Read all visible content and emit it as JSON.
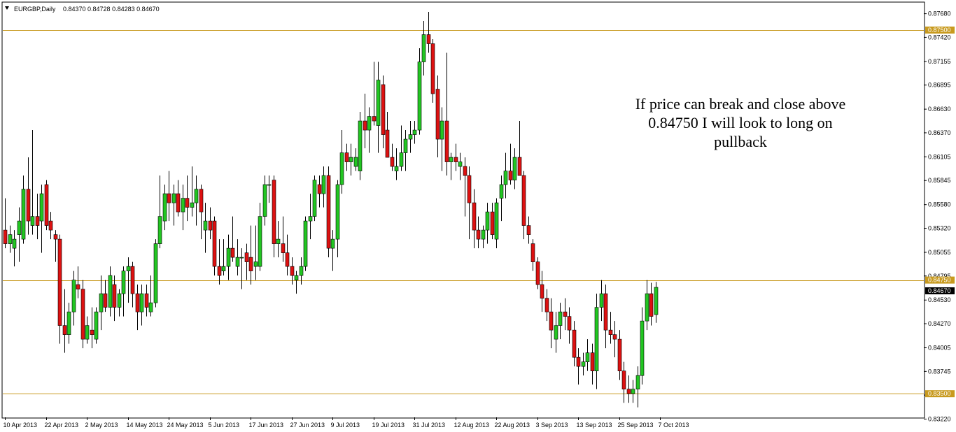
{
  "header": {
    "symbol": "EURGBP,Daily",
    "ohlc": "0.84370 0.84728 0.84283 0.84670"
  },
  "annotation": [
    "If price can break and close above",
    "0.84750 I will look to long on",
    "pullback"
  ],
  "colors": {
    "bull": "#22c622",
    "bear": "#dd1111",
    "outline": "#000000",
    "level_line": "#c89a1e",
    "level_label_bg": "#c89a1e",
    "current_label_bg": "#000000",
    "background": "#ffffff"
  },
  "y_axis": {
    "min": 0.8324,
    "max": 0.878,
    "ticks": [
      "0.87680",
      "0.87420",
      "0.87155",
      "0.86895",
      "0.86630",
      "0.86370",
      "0.86105",
      "0.85845",
      "0.85580",
      "0.85320",
      "0.85055",
      "0.84795",
      "0.84530",
      "0.84270",
      "0.84005",
      "0.83745",
      "0.83485",
      "0.83220"
    ]
  },
  "x_axis": {
    "labels": [
      "10 Apr 2013",
      "22 Apr 2013",
      "2 May 2013",
      "14 May 2013",
      "24 May 2013",
      "5 Jun 2013",
      "17 Jun 2013",
      "27 Jun 2013",
      "9 Jul 2013",
      "19 Jul 2013",
      "31 Jul 2013",
      "12 Aug 2013",
      "22 Aug 2013",
      "3 Sep 2013",
      "13 Sep 2013",
      "25 Sep 2013",
      "7 Oct 2013"
    ]
  },
  "levels": [
    {
      "value": 0.875,
      "label": "0.87500"
    },
    {
      "value": 0.8475,
      "label": "0.84750"
    },
    {
      "value": 0.835,
      "label": "0.83500"
    }
  ],
  "current_price": {
    "value": 0.8467,
    "label": "0.84670"
  },
  "chart_data": {
    "type": "candlestick",
    "symbol": "EURGBP",
    "timeframe": "Daily",
    "series": [
      {
        "date": "2013-04-09",
        "o": 0.853,
        "h": 0.8565,
        "l": 0.851,
        "c": 0.8515
      },
      {
        "date": "2013-04-10",
        "o": 0.8515,
        "h": 0.8535,
        "l": 0.8505,
        "c": 0.8525
      },
      {
        "date": "2013-04-11",
        "o": 0.851,
        "h": 0.853,
        "l": 0.849,
        "c": 0.852
      },
      {
        "date": "2013-04-12",
        "o": 0.8525,
        "h": 0.8555,
        "l": 0.8495,
        "c": 0.854
      },
      {
        "date": "2013-04-15",
        "o": 0.852,
        "h": 0.859,
        "l": 0.8515,
        "c": 0.8575
      },
      {
        "date": "2013-04-16",
        "o": 0.8575,
        "h": 0.861,
        "l": 0.8525,
        "c": 0.854
      },
      {
        "date": "2013-04-17",
        "o": 0.8535,
        "h": 0.864,
        "l": 0.8525,
        "c": 0.8545
      },
      {
        "date": "2013-04-18",
        "o": 0.8545,
        "h": 0.857,
        "l": 0.852,
        "c": 0.8535
      },
      {
        "date": "2013-04-19",
        "o": 0.854,
        "h": 0.858,
        "l": 0.8505,
        "c": 0.857
      },
      {
        "date": "2013-04-22",
        "o": 0.858,
        "h": 0.8585,
        "l": 0.853,
        "c": 0.8535
      },
      {
        "date": "2013-04-23",
        "o": 0.854,
        "h": 0.855,
        "l": 0.852,
        "c": 0.853
      },
      {
        "date": "2013-04-24",
        "o": 0.8525,
        "h": 0.853,
        "l": 0.8495,
        "c": 0.852
      },
      {
        "date": "2013-04-25",
        "o": 0.852,
        "h": 0.8525,
        "l": 0.8405,
        "c": 0.8425
      },
      {
        "date": "2013-04-26",
        "o": 0.8425,
        "h": 0.8465,
        "l": 0.8395,
        "c": 0.8415
      },
      {
        "date": "2013-04-29",
        "o": 0.8415,
        "h": 0.845,
        "l": 0.8405,
        "c": 0.844
      },
      {
        "date": "2013-04-30",
        "o": 0.844,
        "h": 0.8485,
        "l": 0.8425,
        "c": 0.8475
      },
      {
        "date": "2013-05-01",
        "o": 0.847,
        "h": 0.849,
        "l": 0.8455,
        "c": 0.8465
      },
      {
        "date": "2013-05-02",
        "o": 0.8465,
        "h": 0.8475,
        "l": 0.84,
        "c": 0.841
      },
      {
        "date": "2013-05-03",
        "o": 0.841,
        "h": 0.8435,
        "l": 0.8405,
        "c": 0.8425
      },
      {
        "date": "2013-05-06",
        "o": 0.842,
        "h": 0.8445,
        "l": 0.84,
        "c": 0.8415
      },
      {
        "date": "2013-05-07",
        "o": 0.841,
        "h": 0.8445,
        "l": 0.8405,
        "c": 0.844
      },
      {
        "date": "2013-05-08",
        "o": 0.844,
        "h": 0.848,
        "l": 0.842,
        "c": 0.846
      },
      {
        "date": "2013-05-09",
        "o": 0.846,
        "h": 0.8475,
        "l": 0.844,
        "c": 0.8445
      },
      {
        "date": "2013-05-10",
        "o": 0.8445,
        "h": 0.849,
        "l": 0.8435,
        "c": 0.848
      },
      {
        "date": "2013-05-13",
        "o": 0.847,
        "h": 0.848,
        "l": 0.843,
        "c": 0.8445
      },
      {
        "date": "2013-05-14",
        "o": 0.8445,
        "h": 0.8465,
        "l": 0.8435,
        "c": 0.846
      },
      {
        "date": "2013-05-15",
        "o": 0.846,
        "h": 0.849,
        "l": 0.8435,
        "c": 0.8485
      },
      {
        "date": "2013-05-16",
        "o": 0.8485,
        "h": 0.85,
        "l": 0.845,
        "c": 0.849
      },
      {
        "date": "2013-05-17",
        "o": 0.849,
        "h": 0.8495,
        "l": 0.8445,
        "c": 0.846
      },
      {
        "date": "2013-05-20",
        "o": 0.846,
        "h": 0.847,
        "l": 0.842,
        "c": 0.844
      },
      {
        "date": "2013-05-21",
        "o": 0.844,
        "h": 0.847,
        "l": 0.8425,
        "c": 0.846
      },
      {
        "date": "2013-05-22",
        "o": 0.846,
        "h": 0.847,
        "l": 0.8435,
        "c": 0.8445
      },
      {
        "date": "2013-05-23",
        "o": 0.844,
        "h": 0.848,
        "l": 0.8435,
        "c": 0.845
      },
      {
        "date": "2013-05-24",
        "o": 0.845,
        "h": 0.852,
        "l": 0.8445,
        "c": 0.8515
      },
      {
        "date": "2013-05-27",
        "o": 0.8515,
        "h": 0.859,
        "l": 0.851,
        "c": 0.8545
      },
      {
        "date": "2013-05-28",
        "o": 0.854,
        "h": 0.858,
        "l": 0.853,
        "c": 0.857
      },
      {
        "date": "2013-05-29",
        "o": 0.857,
        "h": 0.8595,
        "l": 0.854,
        "c": 0.856
      },
      {
        "date": "2013-05-30",
        "o": 0.856,
        "h": 0.858,
        "l": 0.8535,
        "c": 0.857
      },
      {
        "date": "2013-05-31",
        "o": 0.857,
        "h": 0.8585,
        "l": 0.8545,
        "c": 0.855
      },
      {
        "date": "2013-06-03",
        "o": 0.855,
        "h": 0.858,
        "l": 0.853,
        "c": 0.8565
      },
      {
        "date": "2013-06-04",
        "o": 0.8565,
        "h": 0.859,
        "l": 0.854,
        "c": 0.8555
      },
      {
        "date": "2013-06-05",
        "o": 0.8555,
        "h": 0.86,
        "l": 0.8545,
        "c": 0.856
      },
      {
        "date": "2013-06-06",
        "o": 0.856,
        "h": 0.859,
        "l": 0.8535,
        "c": 0.8575
      },
      {
        "date": "2013-06-07",
        "o": 0.8575,
        "h": 0.858,
        "l": 0.852,
        "c": 0.855
      },
      {
        "date": "2013-06-10",
        "o": 0.853,
        "h": 0.856,
        "l": 0.8505,
        "c": 0.854
      },
      {
        "date": "2013-06-11",
        "o": 0.854,
        "h": 0.8555,
        "l": 0.852,
        "c": 0.853
      },
      {
        "date": "2013-06-12",
        "o": 0.854,
        "h": 0.8545,
        "l": 0.848,
        "c": 0.849
      },
      {
        "date": "2013-06-13",
        "o": 0.849,
        "h": 0.852,
        "l": 0.847,
        "c": 0.848
      },
      {
        "date": "2013-06-14",
        "o": 0.8485,
        "h": 0.852,
        "l": 0.848,
        "c": 0.849
      },
      {
        "date": "2013-06-17",
        "o": 0.849,
        "h": 0.8525,
        "l": 0.8475,
        "c": 0.851
      },
      {
        "date": "2013-06-18",
        "o": 0.851,
        "h": 0.8545,
        "l": 0.8495,
        "c": 0.85
      },
      {
        "date": "2013-06-19",
        "o": 0.849,
        "h": 0.852,
        "l": 0.848,
        "c": 0.85
      },
      {
        "date": "2013-06-20",
        "o": 0.85,
        "h": 0.851,
        "l": 0.8465,
        "c": 0.85
      },
      {
        "date": "2013-06-21",
        "o": 0.8505,
        "h": 0.8515,
        "l": 0.8475,
        "c": 0.8495
      },
      {
        "date": "2013-06-24",
        "o": 0.85,
        "h": 0.8535,
        "l": 0.847,
        "c": 0.8485
      },
      {
        "date": "2013-06-25",
        "o": 0.849,
        "h": 0.8535,
        "l": 0.8475,
        "c": 0.8495
      },
      {
        "date": "2013-06-26",
        "o": 0.849,
        "h": 0.856,
        "l": 0.8485,
        "c": 0.8545
      },
      {
        "date": "2013-06-27",
        "o": 0.8545,
        "h": 0.859,
        "l": 0.8535,
        "c": 0.858
      },
      {
        "date": "2013-06-28",
        "o": 0.858,
        "h": 0.859,
        "l": 0.856,
        "c": 0.858
      },
      {
        "date": "2013-07-01",
        "o": 0.8585,
        "h": 0.859,
        "l": 0.85,
        "c": 0.8515
      },
      {
        "date": "2013-07-02",
        "o": 0.8515,
        "h": 0.854,
        "l": 0.85,
        "c": 0.852
      },
      {
        "date": "2013-07-03",
        "o": 0.8515,
        "h": 0.8545,
        "l": 0.8495,
        "c": 0.8505
      },
      {
        "date": "2013-07-04",
        "o": 0.8505,
        "h": 0.8525,
        "l": 0.848,
        "c": 0.849
      },
      {
        "date": "2013-07-05",
        "o": 0.849,
        "h": 0.85,
        "l": 0.847,
        "c": 0.848
      },
      {
        "date": "2013-07-08",
        "o": 0.8475,
        "h": 0.8485,
        "l": 0.846,
        "c": 0.848
      },
      {
        "date": "2013-07-09",
        "o": 0.848,
        "h": 0.85,
        "l": 0.847,
        "c": 0.849
      },
      {
        "date": "2013-07-10",
        "o": 0.849,
        "h": 0.8545,
        "l": 0.8485,
        "c": 0.854
      },
      {
        "date": "2013-07-11",
        "o": 0.854,
        "h": 0.857,
        "l": 0.852,
        "c": 0.8545
      },
      {
        "date": "2013-07-12",
        "o": 0.8545,
        "h": 0.859,
        "l": 0.854,
        "c": 0.8585
      },
      {
        "date": "2013-07-15",
        "o": 0.858,
        "h": 0.859,
        "l": 0.8555,
        "c": 0.857
      },
      {
        "date": "2013-07-16",
        "o": 0.857,
        "h": 0.86,
        "l": 0.8555,
        "c": 0.859
      },
      {
        "date": "2013-07-17",
        "o": 0.859,
        "h": 0.86,
        "l": 0.85,
        "c": 0.851
      },
      {
        "date": "2013-07-18",
        "o": 0.851,
        "h": 0.853,
        "l": 0.8485,
        "c": 0.852
      },
      {
        "date": "2013-07-19",
        "o": 0.852,
        "h": 0.8585,
        "l": 0.85,
        "c": 0.858
      },
      {
        "date": "2013-07-22",
        "o": 0.858,
        "h": 0.864,
        "l": 0.857,
        "c": 0.8615
      },
      {
        "date": "2013-07-23",
        "o": 0.8615,
        "h": 0.8625,
        "l": 0.8595,
        "c": 0.8605
      },
      {
        "date": "2013-07-24",
        "o": 0.8605,
        "h": 0.8625,
        "l": 0.859,
        "c": 0.861
      },
      {
        "date": "2013-07-25",
        "o": 0.86,
        "h": 0.862,
        "l": 0.8595,
        "c": 0.861
      },
      {
        "date": "2013-07-26",
        "o": 0.8595,
        "h": 0.866,
        "l": 0.8585,
        "c": 0.865
      },
      {
        "date": "2013-07-29",
        "o": 0.865,
        "h": 0.868,
        "l": 0.862,
        "c": 0.864
      },
      {
        "date": "2013-07-30",
        "o": 0.864,
        "h": 0.8665,
        "l": 0.8615,
        "c": 0.8655
      },
      {
        "date": "2013-07-31",
        "o": 0.8655,
        "h": 0.8715,
        "l": 0.8645,
        "c": 0.865
      },
      {
        "date": "2013-08-01",
        "o": 0.8645,
        "h": 0.8715,
        "l": 0.8615,
        "c": 0.8695
      },
      {
        "date": "2013-08-02",
        "o": 0.869,
        "h": 0.87,
        "l": 0.862,
        "c": 0.8635
      },
      {
        "date": "2013-08-05",
        "o": 0.864,
        "h": 0.866,
        "l": 0.861,
        "c": 0.861
      },
      {
        "date": "2013-08-06",
        "o": 0.861,
        "h": 0.8625,
        "l": 0.8595,
        "c": 0.86
      },
      {
        "date": "2013-08-07",
        "o": 0.8595,
        "h": 0.862,
        "l": 0.8585,
        "c": 0.86
      },
      {
        "date": "2013-08-08",
        "o": 0.86,
        "h": 0.8645,
        "l": 0.8595,
        "c": 0.8615
      },
      {
        "date": "2013-08-09",
        "o": 0.8615,
        "h": 0.864,
        "l": 0.8595,
        "c": 0.863
      },
      {
        "date": "2013-08-12",
        "o": 0.863,
        "h": 0.865,
        "l": 0.8615,
        "c": 0.8635
      },
      {
        "date": "2013-08-13",
        "o": 0.8635,
        "h": 0.865,
        "l": 0.8625,
        "c": 0.864
      },
      {
        "date": "2013-08-14",
        "o": 0.864,
        "h": 0.873,
        "l": 0.8635,
        "c": 0.8715
      },
      {
        "date": "2013-08-15",
        "o": 0.8715,
        "h": 0.876,
        "l": 0.87,
        "c": 0.8745
      },
      {
        "date": "2013-08-16",
        "o": 0.8745,
        "h": 0.877,
        "l": 0.8725,
        "c": 0.8735
      },
      {
        "date": "2013-08-19",
        "o": 0.8735,
        "h": 0.874,
        "l": 0.867,
        "c": 0.868
      },
      {
        "date": "2013-08-20",
        "o": 0.8685,
        "h": 0.87,
        "l": 0.861,
        "c": 0.863
      },
      {
        "date": "2013-08-21",
        "o": 0.863,
        "h": 0.8665,
        "l": 0.8595,
        "c": 0.865
      },
      {
        "date": "2013-08-22",
        "o": 0.865,
        "h": 0.8725,
        "l": 0.859,
        "c": 0.8605
      },
      {
        "date": "2013-08-23",
        "o": 0.8605,
        "h": 0.8615,
        "l": 0.8585,
        "c": 0.861
      },
      {
        "date": "2013-08-26",
        "o": 0.861,
        "h": 0.8625,
        "l": 0.8595,
        "c": 0.8605
      },
      {
        "date": "2013-08-27",
        "o": 0.86,
        "h": 0.8615,
        "l": 0.8585,
        "c": 0.8605
      },
      {
        "date": "2013-08-28",
        "o": 0.86,
        "h": 0.861,
        "l": 0.8545,
        "c": 0.859
      },
      {
        "date": "2013-08-29",
        "o": 0.859,
        "h": 0.86,
        "l": 0.852,
        "c": 0.856
      },
      {
        "date": "2013-08-30",
        "o": 0.856,
        "h": 0.8575,
        "l": 0.851,
        "c": 0.853
      },
      {
        "date": "2013-09-02",
        "o": 0.853,
        "h": 0.8545,
        "l": 0.851,
        "c": 0.852
      },
      {
        "date": "2013-09-03",
        "o": 0.852,
        "h": 0.8535,
        "l": 0.851,
        "c": 0.853
      },
      {
        "date": "2013-09-04",
        "o": 0.853,
        "h": 0.856,
        "l": 0.8515,
        "c": 0.855
      },
      {
        "date": "2013-09-05",
        "o": 0.855,
        "h": 0.856,
        "l": 0.852,
        "c": 0.8525
      },
      {
        "date": "2013-09-06",
        "o": 0.852,
        "h": 0.8565,
        "l": 0.851,
        "c": 0.856
      },
      {
        "date": "2013-09-09",
        "o": 0.8565,
        "h": 0.859,
        "l": 0.854,
        "c": 0.858
      },
      {
        "date": "2013-09-10",
        "o": 0.858,
        "h": 0.8615,
        "l": 0.8565,
        "c": 0.8595
      },
      {
        "date": "2013-09-11",
        "o": 0.8595,
        "h": 0.8625,
        "l": 0.858,
        "c": 0.8585
      },
      {
        "date": "2013-09-12",
        "o": 0.8585,
        "h": 0.862,
        "l": 0.8575,
        "c": 0.861
      },
      {
        "date": "2013-09-13",
        "o": 0.861,
        "h": 0.865,
        "l": 0.859,
        "c": 0.859
      },
      {
        "date": "2013-09-16",
        "o": 0.859,
        "h": 0.8595,
        "l": 0.852,
        "c": 0.8535
      },
      {
        "date": "2013-09-17",
        "o": 0.8535,
        "h": 0.8545,
        "l": 0.8515,
        "c": 0.8525
      },
      {
        "date": "2013-09-18",
        "o": 0.8515,
        "h": 0.852,
        "l": 0.8485,
        "c": 0.8495
      },
      {
        "date": "2013-09-19",
        "o": 0.8495,
        "h": 0.85,
        "l": 0.8465,
        "c": 0.847
      },
      {
        "date": "2013-09-20",
        "o": 0.847,
        "h": 0.8485,
        "l": 0.844,
        "c": 0.8455
      },
      {
        "date": "2013-09-23",
        "o": 0.8455,
        "h": 0.8465,
        "l": 0.843,
        "c": 0.844
      },
      {
        "date": "2013-09-24",
        "o": 0.844,
        "h": 0.8455,
        "l": 0.84,
        "c": 0.842
      },
      {
        "date": "2013-09-25",
        "o": 0.841,
        "h": 0.844,
        "l": 0.8395,
        "c": 0.8425
      },
      {
        "date": "2013-09-26",
        "o": 0.8425,
        "h": 0.845,
        "l": 0.841,
        "c": 0.844
      },
      {
        "date": "2013-09-27",
        "o": 0.844,
        "h": 0.8455,
        "l": 0.842,
        "c": 0.8435
      },
      {
        "date": "2013-09-30",
        "o": 0.8435,
        "h": 0.8445,
        "l": 0.8405,
        "c": 0.842
      },
      {
        "date": "2013-10-01",
        "o": 0.842,
        "h": 0.843,
        "l": 0.838,
        "c": 0.839
      },
      {
        "date": "2013-10-02",
        "o": 0.839,
        "h": 0.84,
        "l": 0.836,
        "c": 0.838
      },
      {
        "date": "2013-10-03",
        "o": 0.838,
        "h": 0.8395,
        "l": 0.837,
        "c": 0.8385
      },
      {
        "date": "2013-10-04",
        "o": 0.8385,
        "h": 0.841,
        "l": 0.8375,
        "c": 0.8395
      },
      {
        "date": "2013-10-07",
        "o": 0.8395,
        "h": 0.8405,
        "l": 0.836,
        "c": 0.8375
      },
      {
        "date": "2013-10-08",
        "o": 0.8375,
        "h": 0.846,
        "l": 0.8355,
        "c": 0.8445
      },
      {
        "date": "2013-10-09",
        "o": 0.8445,
        "h": 0.8475,
        "l": 0.843,
        "c": 0.846
      },
      {
        "date": "2013-10-10",
        "o": 0.846,
        "h": 0.847,
        "l": 0.84,
        "c": 0.842
      },
      {
        "date": "2013-10-11",
        "o": 0.842,
        "h": 0.844,
        "l": 0.8405,
        "c": 0.8415
      },
      {
        "date": "2013-10-14",
        "o": 0.8415,
        "h": 0.843,
        "l": 0.839,
        "c": 0.841
      },
      {
        "date": "2013-10-15",
        "o": 0.841,
        "h": 0.842,
        "l": 0.8365,
        "c": 0.8375
      },
      {
        "date": "2013-10-16",
        "o": 0.8375,
        "h": 0.8385,
        "l": 0.834,
        "c": 0.8355
      },
      {
        "date": "2013-10-17",
        "o": 0.8355,
        "h": 0.837,
        "l": 0.834,
        "c": 0.835
      },
      {
        "date": "2013-10-18",
        "o": 0.835,
        "h": 0.8365,
        "l": 0.834,
        "c": 0.8355
      },
      {
        "date": "2013-10-21",
        "o": 0.8355,
        "h": 0.838,
        "l": 0.8335,
        "c": 0.837
      },
      {
        "date": "2013-10-22",
        "o": 0.837,
        "h": 0.8445,
        "l": 0.836,
        "c": 0.843
      },
      {
        "date": "2013-10-23",
        "o": 0.843,
        "h": 0.8475,
        "l": 0.842,
        "c": 0.846
      },
      {
        "date": "2013-10-24",
        "o": 0.846,
        "h": 0.8472,
        "l": 0.8425,
        "c": 0.8435
      },
      {
        "date": "2013-10-25",
        "o": 0.8437,
        "h": 0.8473,
        "l": 0.8428,
        "c": 0.8467
      }
    ]
  }
}
